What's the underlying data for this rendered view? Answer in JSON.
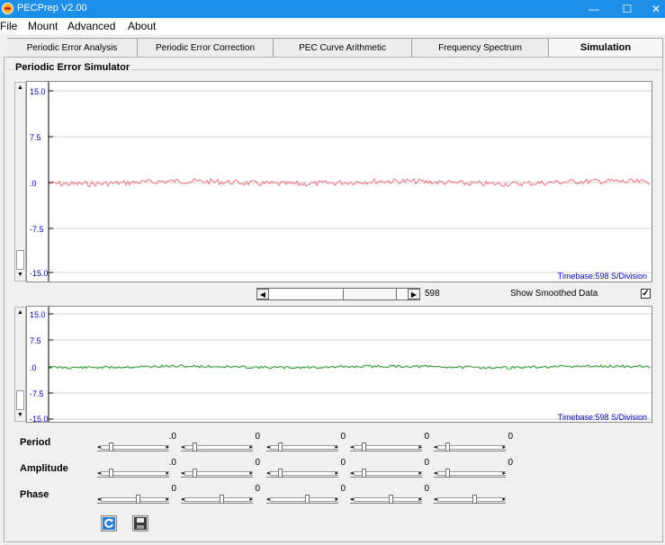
{
  "window": {
    "title": "PECPrep V2.00",
    "min": "—",
    "max": "☐",
    "close": "✕"
  },
  "menu": [
    "File",
    "Mount",
    "Advanced",
    "About"
  ],
  "tabs": [
    {
      "label": "Periodic Error Analysis",
      "active": false
    },
    {
      "label": "Periodic Error Correction",
      "active": false
    },
    {
      "label": "PEC Curve Arithmetic",
      "active": false
    },
    {
      "label": "Frequency Spectrum",
      "active": false
    },
    {
      "label": "Simulation",
      "active": true
    }
  ],
  "group_title": "Periodic Error Simulator",
  "chart_top": {
    "yticks": [
      "15.0",
      "7.5",
      ".0",
      "-7.5",
      "-15.0"
    ],
    "timebase": "Timebase:598 S/Division",
    "line_color": "#f07080"
  },
  "chart_bottom": {
    "yticks": [
      "15.0",
      "7.5",
      ".0",
      "-7.5",
      "-15.0"
    ],
    "timebase": "Timebase:598 S/Division",
    "line_color": "#2aa02a"
  },
  "chart_data": [
    {
      "type": "line",
      "series": [
        {
          "values": [
            0.0
          ]
        }
      ],
      "ylim": [
        -15,
        15
      ]
    },
    {
      "type": "line",
      "series": [
        {
          "values": [
            0.0
          ]
        }
      ],
      "ylim": [
        -15,
        15
      ]
    }
  ],
  "scroll_value": "598",
  "show_smoothed": {
    "label": "Show Smoothed Data",
    "checked": true,
    "mark": "✓"
  },
  "params": {
    "period": {
      "label": "Period",
      "values": [
        ".0",
        "0",
        "0",
        "0",
        "0"
      ]
    },
    "amplitude": {
      "label": "Amplitude",
      "values": [
        ".0",
        "0",
        "0",
        "0",
        "0"
      ]
    },
    "phase": {
      "label": "Phase",
      "values": [
        "0",
        "0",
        "0",
        "0"
      ]
    }
  },
  "icons": {
    "refresh": "refresh-icon",
    "save": "save-icon"
  }
}
